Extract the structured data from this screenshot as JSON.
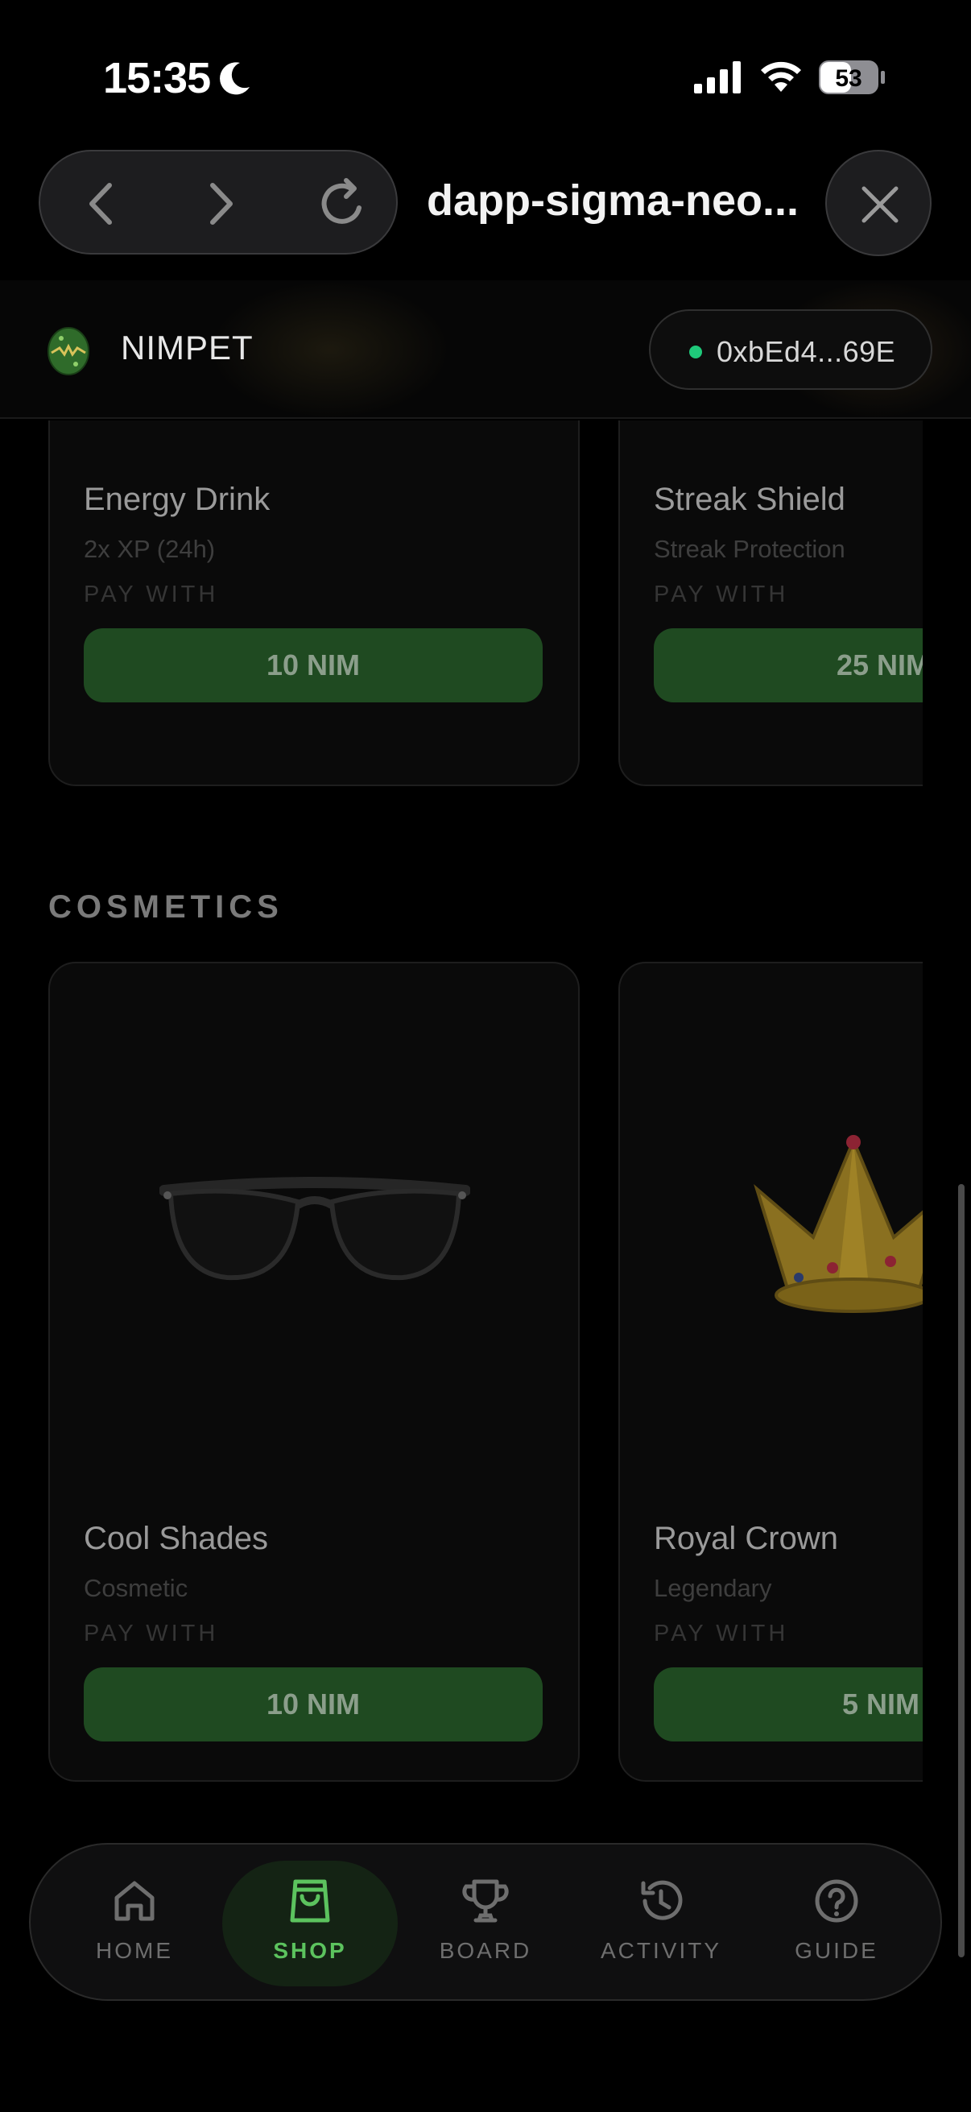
{
  "status_bar": {
    "time": "15:35",
    "battery": "53"
  },
  "browser": {
    "title": "dapp-sigma-neo..."
  },
  "header": {
    "brand": "NIMPET",
    "wallet": "0xbEd4...69E",
    "wallet_status_color": "#1fc97a"
  },
  "boosters": [
    {
      "name": "Energy Drink",
      "subtitle": "2x XP (24h)",
      "pay_label": "PAY WITH",
      "price": "10 NIM"
    },
    {
      "name": "Streak Shield",
      "subtitle": "Streak Protection",
      "pay_label": "PAY WITH",
      "price": "25 NIM"
    }
  ],
  "cosmetics": {
    "title": "COSMETICS",
    "items": [
      {
        "name": "Cool Shades",
        "subtitle": "Cosmetic",
        "pay_label": "PAY WITH",
        "price": "10 NIM"
      },
      {
        "name": "Royal Crown",
        "subtitle": "Legendary",
        "pay_label": "PAY WITH",
        "price": "5 NIM"
      }
    ]
  },
  "bottom_nav": [
    {
      "label": "HOME",
      "icon": "home-icon"
    },
    {
      "label": "SHOP",
      "icon": "shopping-bag-icon",
      "active": true
    },
    {
      "label": "BOARD",
      "icon": "trophy-icon"
    },
    {
      "label": "ACTIVITY",
      "icon": "history-icon"
    },
    {
      "label": "GUIDE",
      "icon": "help-icon"
    }
  ],
  "colors": {
    "accent": "#5cc35e",
    "button": "#1f4a21",
    "background": "#000000"
  }
}
